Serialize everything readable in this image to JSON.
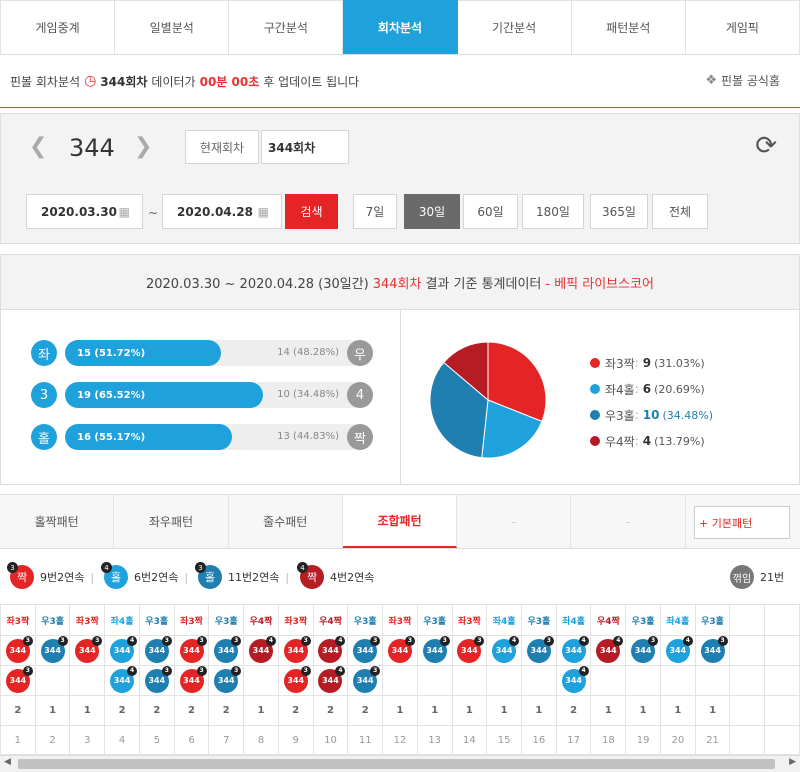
{
  "tabs": [
    "게임중계",
    "일별분석",
    "구간분석",
    "회차분석",
    "기간분석",
    "패턴분석",
    "게임픽"
  ],
  "active_tab": 3,
  "notice": {
    "prefix": "핀볼 회차분석",
    "round": "344회차",
    "middle": "데이터가",
    "time": "00분 00초",
    "suffix": "후 업데이트 됩니다",
    "official": "핀볼 공식홈"
  },
  "round": {
    "number": "344",
    "current_label": "현재회차",
    "input_value": "344회차",
    "date_from": "2020.03.30",
    "date_to": "2020.04.28",
    "tilde": "~",
    "search": "검색",
    "periods": [
      "7일",
      "30일",
      "60일",
      "180일",
      "365일",
      "전체"
    ],
    "active_period": 1
  },
  "stats": {
    "head_prefix": "2020.03.30 ~ 2020.04.28 (30일간)",
    "head_round": "344회차",
    "head_mid": "결과 기준 통계데이터",
    "head_brand": "- 베픽 라이브스코어",
    "rows": [
      {
        "left_label": "좌",
        "left_text": "15 (51.72%)",
        "left_pct": 51.72,
        "right_text": "14 (48.28%)",
        "right_label": "우"
      },
      {
        "left_label": "3",
        "left_text": "19 (65.52%)",
        "left_pct": 65.52,
        "right_text": "10 (34.48%)",
        "right_label": "4"
      },
      {
        "left_label": "홀",
        "left_text": "16 (55.17%)",
        "left_pct": 55.17,
        "right_text": "13 (44.83%)",
        "right_label": "짝"
      }
    ],
    "legend": [
      {
        "label": "좌3짝",
        "value": "9",
        "pct": "(31.03%)",
        "color": "#e52525"
      },
      {
        "label": "좌4홀",
        "value": "6",
        "pct": "(20.69%)",
        "color": "#1fa2dc"
      },
      {
        "label": "우3홀",
        "value": "10",
        "pct": "(34.48%)",
        "color": "#1f7fb0"
      },
      {
        "label": "우4짝",
        "value": "4",
        "pct": "(13.79%)",
        "color": "#b51c24"
      }
    ]
  },
  "pattern_tabs": [
    "홀짝패턴",
    "좌우패턴",
    "줄수패턴",
    "조합패턴",
    "-",
    "-"
  ],
  "active_pattern_tab": 3,
  "basic_pattern": "+ 기본패턴",
  "summary": [
    {
      "ball": "짝",
      "sup": "3",
      "color": "#e52525",
      "text": "9번2연속"
    },
    {
      "ball": "홀",
      "sup": "4",
      "color": "#1fa2dc",
      "text": "6번2연속"
    },
    {
      "ball": "홀",
      "sup": "3",
      "color": "#1f7fb0",
      "text": "11번2연속"
    },
    {
      "ball": "짝",
      "sup": "4",
      "color": "#b51c24",
      "text": "4번2연속"
    }
  ],
  "flip": {
    "ball": "꺾임",
    "text": "21번"
  },
  "grid": {
    "headers": [
      "좌3짝",
      "우3홀",
      "좌3짝",
      "좌4홀",
      "우3홀",
      "좌3짝",
      "우3홀",
      "우4짝",
      "좌3짝",
      "우4짝",
      "우3홀",
      "좌3짝",
      "우3홀",
      "좌3짝",
      "좌4홀",
      "우3홀",
      "좌4홀",
      "우4짝",
      "우3홀",
      "좌4홀",
      "우3홀",
      "",
      ""
    ],
    "row1": [
      "좌3짝",
      "우3홀",
      "좌3짝",
      "좌4홀",
      "우3홀",
      "좌3짝",
      "우3홀",
      "우4짝",
      "좌3짝",
      "우4짝",
      "우3홀",
      "좌3짝",
      "우3홀",
      "좌3짝",
      "좌4홀",
      "우3홀",
      "좌4홀",
      "우4짝",
      "우3홀",
      "좌4홀",
      "우3홀",
      "",
      ""
    ],
    "row2": [
      "좌3짝",
      "",
      "",
      "좌4홀",
      "우3홀",
      "좌3짝",
      "우3홀",
      "",
      "좌3짝",
      "우4짝",
      "우3홀",
      "",
      "",
      "",
      "",
      "",
      "좌4홀",
      "",
      "",
      "",
      "",
      "",
      ""
    ],
    "counts": [
      "2",
      "1",
      "1",
      "2",
      "2",
      "2",
      "2",
      "1",
      "2",
      "2",
      "2",
      "1",
      "1",
      "1",
      "1",
      "1",
      "2",
      "1",
      "1",
      "1",
      "1",
      "",
      ""
    ],
    "index": [
      "1",
      "2",
      "3",
      "4",
      "5",
      "6",
      "7",
      "8",
      "9",
      "10",
      "11",
      "12",
      "13",
      "14",
      "15",
      "16",
      "17",
      "18",
      "19",
      "20",
      "21",
      "",
      ""
    ],
    "ball_text": "344"
  }
}
